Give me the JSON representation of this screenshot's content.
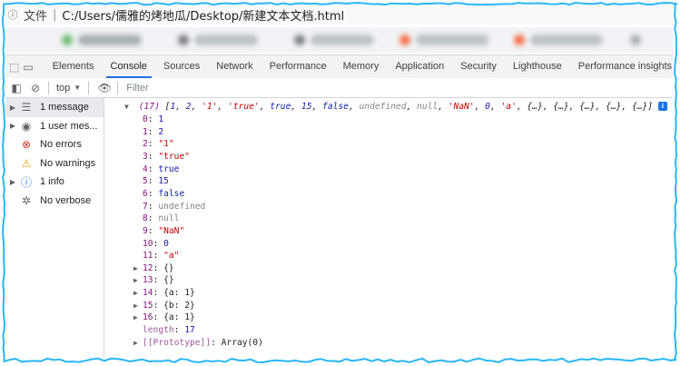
{
  "address_bar": {
    "label": "文件",
    "separator": "|",
    "url": "C:/Users/儒雅的烤地瓜/Desktop/新建文本文档.html"
  },
  "devtools": {
    "tabs": [
      {
        "label": "Elements"
      },
      {
        "label": "Console"
      },
      {
        "label": "Sources"
      },
      {
        "label": "Network"
      },
      {
        "label": "Performance"
      },
      {
        "label": "Memory"
      },
      {
        "label": "Application"
      },
      {
        "label": "Security"
      },
      {
        "label": "Lighthouse"
      },
      {
        "label": "Performance insights"
      }
    ],
    "active_tab": "Console"
  },
  "console_toolbar": {
    "context": "top",
    "filter_placeholder": "Filter"
  },
  "sidebar": {
    "items": [
      {
        "label": "1 message",
        "icon": "list-icon"
      },
      {
        "label": "1 user mes...",
        "icon": "user-icon"
      },
      {
        "label": "No errors",
        "icon": "error-icon"
      },
      {
        "label": "No warnings",
        "icon": "warning-icon"
      },
      {
        "label": "1 info",
        "icon": "info-icon"
      },
      {
        "label": "No verbose",
        "icon": "bug-icon"
      }
    ]
  },
  "console": {
    "summary": {
      "count": "(17)",
      "preview_open": "[",
      "preview_items": [
        {
          "t": "num",
          "v": "1"
        },
        {
          "t": "num",
          "v": "2"
        },
        {
          "t": "str",
          "v": "'1'"
        },
        {
          "t": "str",
          "v": "'true'"
        },
        {
          "t": "kw",
          "v": "true"
        },
        {
          "t": "num",
          "v": "15"
        },
        {
          "t": "kw",
          "v": "false"
        },
        {
          "t": "gray",
          "v": "undefined"
        },
        {
          "t": "gray",
          "v": "null"
        },
        {
          "t": "str",
          "v": "'NaN'"
        },
        {
          "t": "num",
          "v": "0"
        },
        {
          "t": "str",
          "v": "'a'"
        },
        {
          "t": "plain",
          "v": "{…}"
        },
        {
          "t": "plain",
          "v": "{…}"
        },
        {
          "t": "plain",
          "v": "{…}"
        },
        {
          "t": "plain",
          "v": "{…}"
        },
        {
          "t": "plain",
          "v": "{…}"
        }
      ],
      "preview_close": "]",
      "badge": "i"
    },
    "entries": [
      {
        "key": "0",
        "value": "1",
        "type": "num",
        "expandable": false
      },
      {
        "key": "1",
        "value": "2",
        "type": "num",
        "expandable": false
      },
      {
        "key": "2",
        "value": "\"1\"",
        "type": "str",
        "expandable": false
      },
      {
        "key": "3",
        "value": "\"true\"",
        "type": "str",
        "expandable": false
      },
      {
        "key": "4",
        "value": "true",
        "type": "kw",
        "expandable": false
      },
      {
        "key": "5",
        "value": "15",
        "type": "num",
        "expandable": false
      },
      {
        "key": "6",
        "value": "false",
        "type": "kw",
        "expandable": false
      },
      {
        "key": "7",
        "value": "undefined",
        "type": "gray",
        "expandable": false
      },
      {
        "key": "8",
        "value": "null",
        "type": "gray",
        "expandable": false
      },
      {
        "key": "9",
        "value": "\"NaN\"",
        "type": "str",
        "expandable": false
      },
      {
        "key": "10",
        "value": "0",
        "type": "num",
        "expandable": false
      },
      {
        "key": "11",
        "value": "\"a\"",
        "type": "str",
        "expandable": false
      },
      {
        "key": "12",
        "value": "{}",
        "type": "plain",
        "expandable": true
      },
      {
        "key": "13",
        "value": "{}",
        "type": "plain",
        "expandable": true
      },
      {
        "key": "14",
        "value": "{a: 1}",
        "type": "plain",
        "expandable": true
      },
      {
        "key": "15",
        "value": "{b: 2}",
        "type": "plain",
        "expandable": true
      },
      {
        "key": "16",
        "value": "{a: 1}",
        "type": "plain",
        "expandable": true
      },
      {
        "key": "length",
        "value": "17",
        "type": "num",
        "expandable": false,
        "gray_key": true
      },
      {
        "key": "[[Prototype]]",
        "value": "Array(0)",
        "type": "plain",
        "expandable": true,
        "gray_key": true
      }
    ]
  },
  "colors": {
    "accent": "#1a73e8",
    "key": "#881280",
    "number": "#1a1aa6",
    "string": "#c80000",
    "keyword": "#0d22aa",
    "muted": "#80868b",
    "error": "#d93025",
    "warning": "#f29900",
    "border_effect": "#29b6f6"
  }
}
